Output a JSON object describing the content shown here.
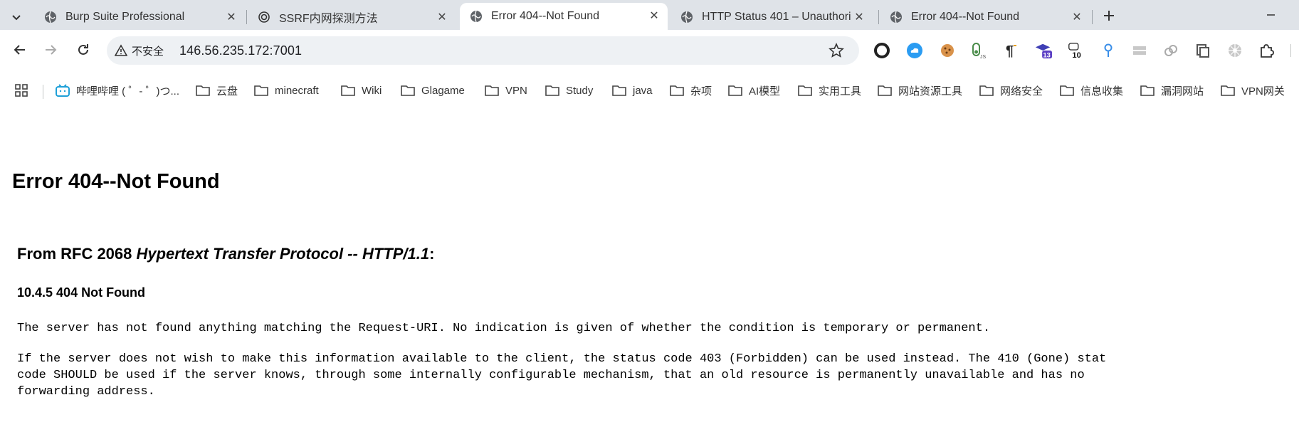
{
  "tabs": [
    {
      "title": "Burp Suite Professional",
      "favicon": "globe-icon"
    },
    {
      "title": "SSRF内网探测方法",
      "favicon": "openai-icon"
    },
    {
      "title": "Error 404--Not Found",
      "favicon": "globe-icon",
      "active": true
    },
    {
      "title": "HTTP Status 401 – Unauthori",
      "favicon": "globe-icon"
    },
    {
      "title": "Error 404--Not Found",
      "favicon": "globe-icon"
    }
  ],
  "toolbar": {
    "security_label": "不安全",
    "url": "146.56.235.172:7001"
  },
  "extensions": [
    {
      "name": "circle-icon"
    },
    {
      "name": "cloud-icon"
    },
    {
      "name": "cookie-icon"
    },
    {
      "name": "js-toggle-icon",
      "label": "JS"
    },
    {
      "name": "pilcrow-icon"
    },
    {
      "name": "graduation-cap-icon",
      "badge": "13"
    },
    {
      "name": "cow-icon",
      "badge": "10"
    },
    {
      "name": "pin-icon"
    },
    {
      "name": "stack-icon"
    },
    {
      "name": "link-icon"
    },
    {
      "name": "copy-icon"
    },
    {
      "name": "gear-flower-icon"
    },
    {
      "name": "puzzle-icon"
    }
  ],
  "bookmarks": [
    {
      "label": "哔哩哔哩 ( ゜- ゜)つ...",
      "icon": "bilibili-icon"
    },
    {
      "label": "云盘",
      "icon": "folder-icon"
    },
    {
      "label": "minecraft",
      "icon": "folder-icon"
    },
    {
      "label": "Wiki",
      "icon": "folder-icon"
    },
    {
      "label": "Glagame",
      "icon": "folder-icon"
    },
    {
      "label": "VPN",
      "icon": "folder-icon"
    },
    {
      "label": "Study",
      "icon": "folder-icon"
    },
    {
      "label": "java",
      "icon": "folder-icon"
    },
    {
      "label": "杂项",
      "icon": "folder-icon"
    },
    {
      "label": "AI模型",
      "icon": "folder-icon"
    },
    {
      "label": "实用工具",
      "icon": "folder-icon"
    },
    {
      "label": "网站资源工具",
      "icon": "folder-icon"
    },
    {
      "label": "网络安全",
      "icon": "folder-icon"
    },
    {
      "label": "信息收集",
      "icon": "folder-icon"
    },
    {
      "label": "漏洞网站",
      "icon": "folder-icon"
    },
    {
      "label": "VPN网关",
      "icon": "folder-icon"
    }
  ],
  "page": {
    "heading": "Error 404--Not Found",
    "rfc_prefix": "From RFC 2068 ",
    "rfc_title": "Hypertext Transfer Protocol -- HTTP/1.1",
    "rfc_suffix": ":",
    "section": "10.4.5 404 Not Found",
    "para1": "The server has not found anything matching the Request-URI. No indication is given of whether the condition is temporary or permanent.",
    "para2_line1": "If the server does not wish to make this information available to the client, the status code 403 (Forbidden) can be used instead. The 410 (Gone) stat",
    "para2_line2": "code SHOULD be used if the server knows, through some internally configurable mechanism, that an old resource is permanently unavailable and has no",
    "para2_line3": "forwarding address."
  }
}
